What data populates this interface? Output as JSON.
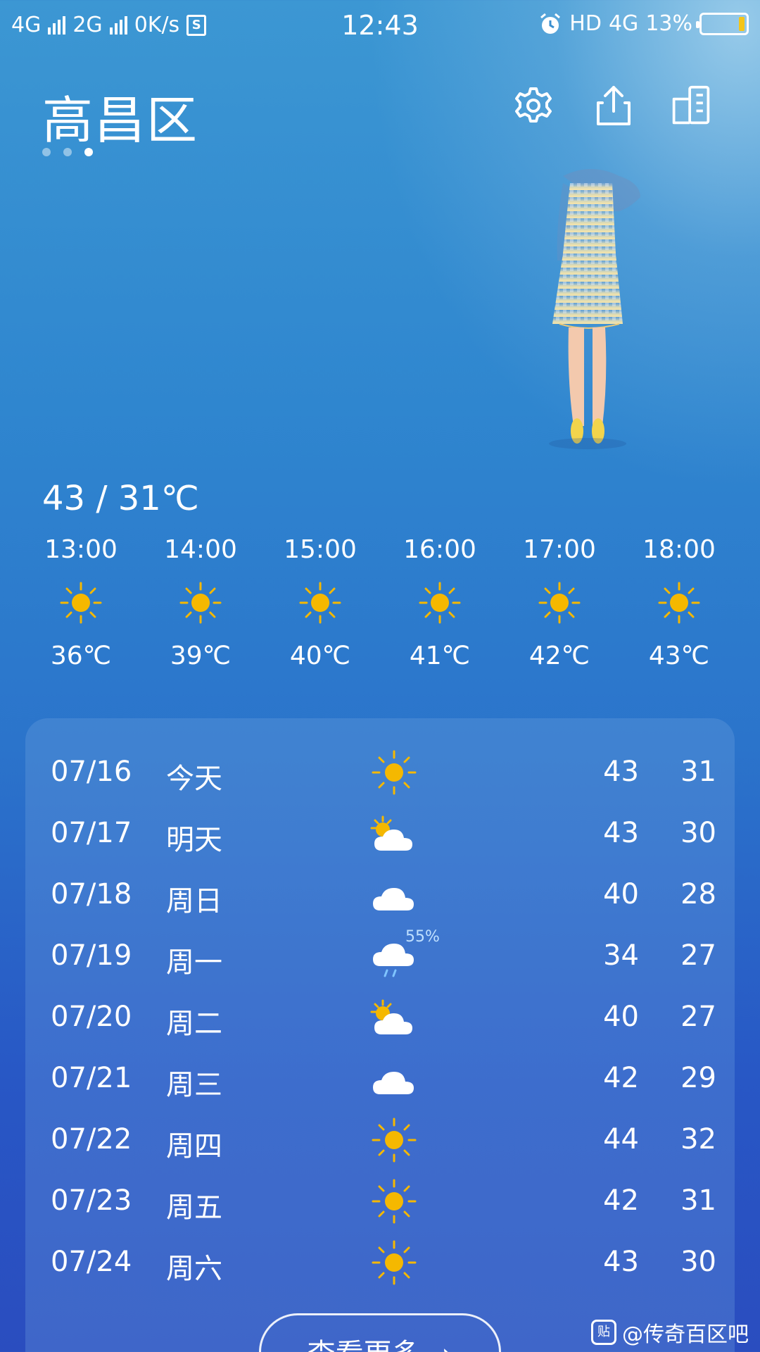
{
  "status_bar": {
    "net1": "4G",
    "net2": "2G",
    "speed": "0K/s",
    "sd": "S",
    "time": "12:43",
    "hd": "HD",
    "net3": "4G",
    "battery": "13%"
  },
  "header": {
    "city": "高昌区",
    "pages": 3,
    "active_page": 3,
    "settings_icon": "gear-icon",
    "share_icon": "share-icon",
    "city_manage_icon": "buildings-icon"
  },
  "today": {
    "range": "43 / 31℃"
  },
  "hourly": [
    {
      "time": "13:00",
      "icon": "sun-icon",
      "temp": "36℃"
    },
    {
      "time": "14:00",
      "icon": "sun-icon",
      "temp": "39℃"
    },
    {
      "time": "15:00",
      "icon": "sun-icon",
      "temp": "40℃"
    },
    {
      "time": "16:00",
      "icon": "sun-icon",
      "temp": "41℃"
    },
    {
      "time": "17:00",
      "icon": "sun-icon",
      "temp": "42℃"
    },
    {
      "time": "18:00",
      "icon": "sun-icon",
      "temp": "43℃"
    }
  ],
  "daily": [
    {
      "date": "07/16",
      "day": "今天",
      "icon": "sun",
      "pop": "",
      "hi": "43",
      "lo": "31"
    },
    {
      "date": "07/17",
      "day": "明天",
      "icon": "partly-cloudy",
      "pop": "",
      "hi": "43",
      "lo": "30"
    },
    {
      "date": "07/18",
      "day": "周日",
      "icon": "cloud",
      "pop": "",
      "hi": "40",
      "lo": "28"
    },
    {
      "date": "07/19",
      "day": "周一",
      "icon": "rain",
      "pop": "55%",
      "hi": "34",
      "lo": "27"
    },
    {
      "date": "07/20",
      "day": "周二",
      "icon": "partly-cloudy",
      "pop": "",
      "hi": "40",
      "lo": "27"
    },
    {
      "date": "07/21",
      "day": "周三",
      "icon": "cloud",
      "pop": "",
      "hi": "42",
      "lo": "29"
    },
    {
      "date": "07/22",
      "day": "周四",
      "icon": "sun",
      "pop": "",
      "hi": "44",
      "lo": "32"
    },
    {
      "date": "07/23",
      "day": "周五",
      "icon": "sun",
      "pop": "",
      "hi": "42",
      "lo": "31"
    },
    {
      "date": "07/24",
      "day": "周六",
      "icon": "sun",
      "pop": "",
      "hi": "43",
      "lo": "30"
    }
  ],
  "more_button": "查看更多",
  "watermark": {
    "logo": "贴",
    "text": "@传奇百区吧"
  },
  "colors": {
    "sun": "#f5b800",
    "accent_battery": "#f5c518"
  }
}
